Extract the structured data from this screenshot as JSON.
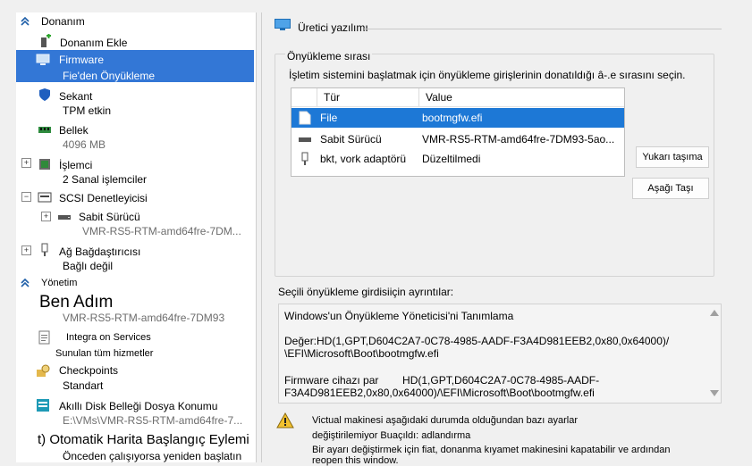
{
  "tree": {
    "hardware_header": "Donanım",
    "add_hardware": "Donanım Ekle",
    "firmware": {
      "label": "Firmware",
      "sub": "Fie'den Önyükleme"
    },
    "security": {
      "label": "Sekant",
      "sub": "TPM etkin"
    },
    "memory": {
      "label": "Bellek",
      "sub": "4096 MB"
    },
    "processor": {
      "label": "İşlemci",
      "sub": "2 Sanal işlemciler"
    },
    "scsi": {
      "label": "SCSI Denetleyicisi"
    },
    "hard_drive": {
      "label": "Sabit Sürücü",
      "sub": "VMR-RS5-RTM-amd64fre-7DM..."
    },
    "network": {
      "label": "Ağ Bağdaştırıcısı",
      "sub": "Bağlı değil"
    },
    "management_header": "Yönetim",
    "name": {
      "label": "Ben Adım",
      "sub": "VMR-RS5-RTM-amd64fre-7DM93"
    },
    "integration": {
      "label": "Integra on Services",
      "sub": "Sunulan tüm hizmetler"
    },
    "checkpoints": {
      "label": "Checkpoints",
      "sub": "Standart"
    },
    "paging": {
      "label": "Akıllı Disk Belleği Dosya Konumu",
      "sub": "E:\\VMs\\VMR-RS5-RTM-amd64fre-7..."
    },
    "autostart": {
      "label": "t) Otomatik Harita Başlangıç Eylemi",
      "sub": "Önceden çalışıyorsa yeniden başlatın"
    }
  },
  "panel": {
    "title": "Üretici yazılımı",
    "boot_order_title": "Önyükleme sırası",
    "instruction": "İşletim sistemini başlatmak için önyükleme girişlerinin donatıldığı â-.e sırasını seçin.",
    "columns": {
      "type": "Tür",
      "value": "Value"
    },
    "rows": [
      {
        "type": "File",
        "value": "bootmgfw.efi"
      },
      {
        "type": "Sabit Sürücü",
        "value": "VMR-RS5-RTM-amd64fre-7DM93-5ao..."
      },
      {
        "type": "bkt, vork adaptörü",
        "value": "Düzeltilmedi"
      }
    ],
    "move_up": "Yukarı taşıma",
    "move_down": "Aşağı Taşı",
    "details_label": "Seçili önyükleme girdisiiçin ayrıntılar:",
    "details": {
      "line1": "Windows'un Önyükleme Yöneticisi'ni Tanımlama",
      "line2": "Değer:HD(1,GPT,D604C2A7-0C78-4985-AADF-F3A4D981EEB2,0x80,0x64000)/",
      "line3": "\\EFI\\Microsoft\\Boot\\bootmgfw.efi",
      "line4": "Firmware cihazı par        HD(1,GPT,D604C2A7-0C78-4985-AADF-",
      "line5": "F3A4D981EEB2,0x80,0x64000)/\\EFI\\Microsoft\\Boot\\bootmgfw.efi"
    },
    "warning": {
      "line1": "Victual makinesi aşağıdaki durumda olduğundan bazı ayarlar",
      "line2": "değiştirilemiyor Buaçıldı: adlandırma",
      "line3": "Bir ayarı değiştirmek için fiat, donanma kıyamet makinesini kapatabilir ve ardından",
      "line4": "reopen this window."
    }
  }
}
